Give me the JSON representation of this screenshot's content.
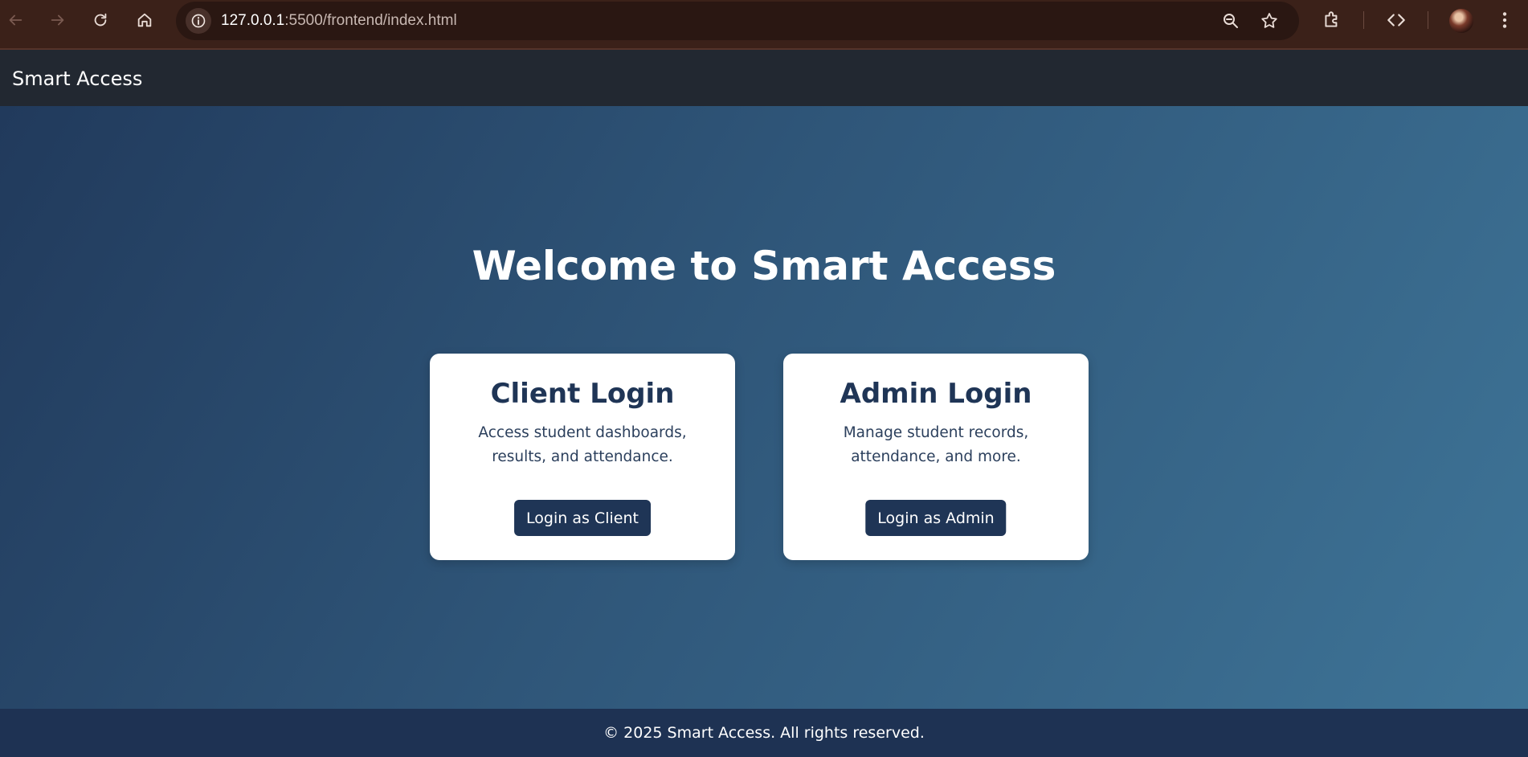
{
  "browser": {
    "url_host": "127.0.0.1",
    "url_rest": ":5500/frontend/index.html",
    "icons": [
      "back-icon",
      "forward-icon",
      "reload-icon",
      "home-icon",
      "site-info-icon",
      "zoom-icon",
      "bookmark-star-icon",
      "extensions-icon",
      "devtools-icon",
      "profile-avatar",
      "menu-kebab-icon"
    ]
  },
  "navbar": {
    "brand": "Smart Access"
  },
  "hero": {
    "title": "Welcome to Smart Access"
  },
  "cards": [
    {
      "title": "Client Login",
      "description": "Access student dashboards, results, and attendance.",
      "button_label": "Login as Client"
    },
    {
      "title": "Admin Login",
      "description": "Manage student records, attendance, and more.",
      "button_label": "Login as Admin"
    }
  ],
  "footer": {
    "text": "© 2025 Smart Access. All rights reserved."
  },
  "colors": {
    "browser_frame": "#3b2119",
    "navbar_bg": "#222831",
    "gradient_start": "#213a5c",
    "gradient_end": "#3e7497",
    "card_bg": "#ffffff",
    "primary_dark": "#1f3556",
    "footer_bg": "#1e3253"
  }
}
